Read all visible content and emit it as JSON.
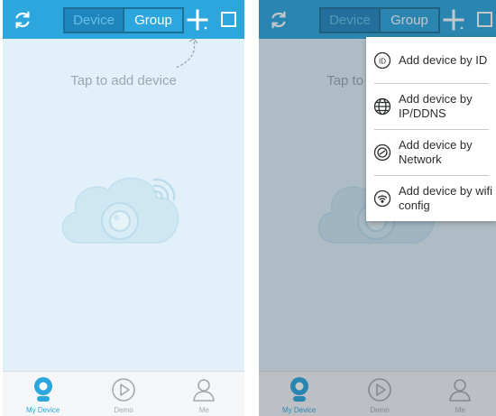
{
  "colors": {
    "header": "#2ca6dc",
    "segment_active": "#1f86bd",
    "content_bg": "#e2f1f9",
    "tab_selected": "#2ca6dc",
    "tab_normal": "#a5a9ad"
  },
  "left_screen": {
    "header": {
      "segment_device": "Device",
      "segment_group": "Group",
      "selected_segment": "Device",
      "icons": [
        "refresh-icon",
        "add-icon",
        "select-square-icon"
      ]
    },
    "hint_text": "Tap to add device",
    "illustration": "cloud-camera-wifi-icon",
    "tabs": [
      {
        "label": "My Device",
        "icon": "camera-icon",
        "selected": true
      },
      {
        "label": "Demo",
        "icon": "play-icon",
        "selected": false
      },
      {
        "label": "Me",
        "icon": "user-icon",
        "selected": false
      }
    ]
  },
  "right_screen": {
    "header": {
      "segment_device": "Device",
      "segment_group": "Group"
    },
    "hint_text": "Tap to add device",
    "tabs": [
      {
        "label": "My Device"
      },
      {
        "label": "Demo"
      },
      {
        "label": "Me"
      }
    ],
    "menu": {
      "items": [
        {
          "label": "Add device by ID",
          "icon": "id-icon"
        },
        {
          "label": "Add device by IP/DDNS",
          "icon": "globe-icon"
        },
        {
          "label": "Add device by Network",
          "icon": "network-icon"
        },
        {
          "label": "Add device by wifi config",
          "icon": "wifi-icon"
        }
      ]
    }
  }
}
